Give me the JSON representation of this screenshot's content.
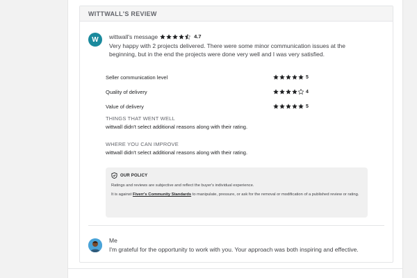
{
  "review": {
    "header": "WITTWALL'S REVIEW",
    "avatar_letter": "W",
    "reviewer_message_label": "wittwall's message",
    "overall_rating": "4.7",
    "message": "Very happy with 2 projects delivered. There were some minor communication issues at the beginning, but in the end the projects were done very well and I was very satisfied."
  },
  "ratings": [
    {
      "label": "Seller communication level",
      "value": "5",
      "stars": 5
    },
    {
      "label": "Quality of delivery",
      "value": "4",
      "stars": 4
    },
    {
      "label": "Value of delivery",
      "value": "5",
      "stars": 5
    }
  ],
  "went_well": {
    "title": "THINGS THAT WENT WELL",
    "text": "wittwall didn't select additional reasons along with their rating."
  },
  "improve": {
    "title": "WHERE YOU CAN IMPROVE",
    "text": "wittwall didn't select additional reasons along with their rating."
  },
  "policy": {
    "title": "OUR POLICY",
    "text1": "Ratings and reviews are subjective and reflect the buyer's individual experience.",
    "text2_pre": "It is against ",
    "link": "Fiverr's Community Standards",
    "text2_post": " to manipulate, pressure, or ask for the removal or modification of a published review or rating."
  },
  "reply": {
    "name": "Me",
    "text": "I'm grateful for the opportunity to work with you. Your approach was both inspiring and effective."
  },
  "colors": {
    "avatar_teal": "#1a8a9d",
    "star": "#222325",
    "policy_bg": "#f0f0f0"
  }
}
